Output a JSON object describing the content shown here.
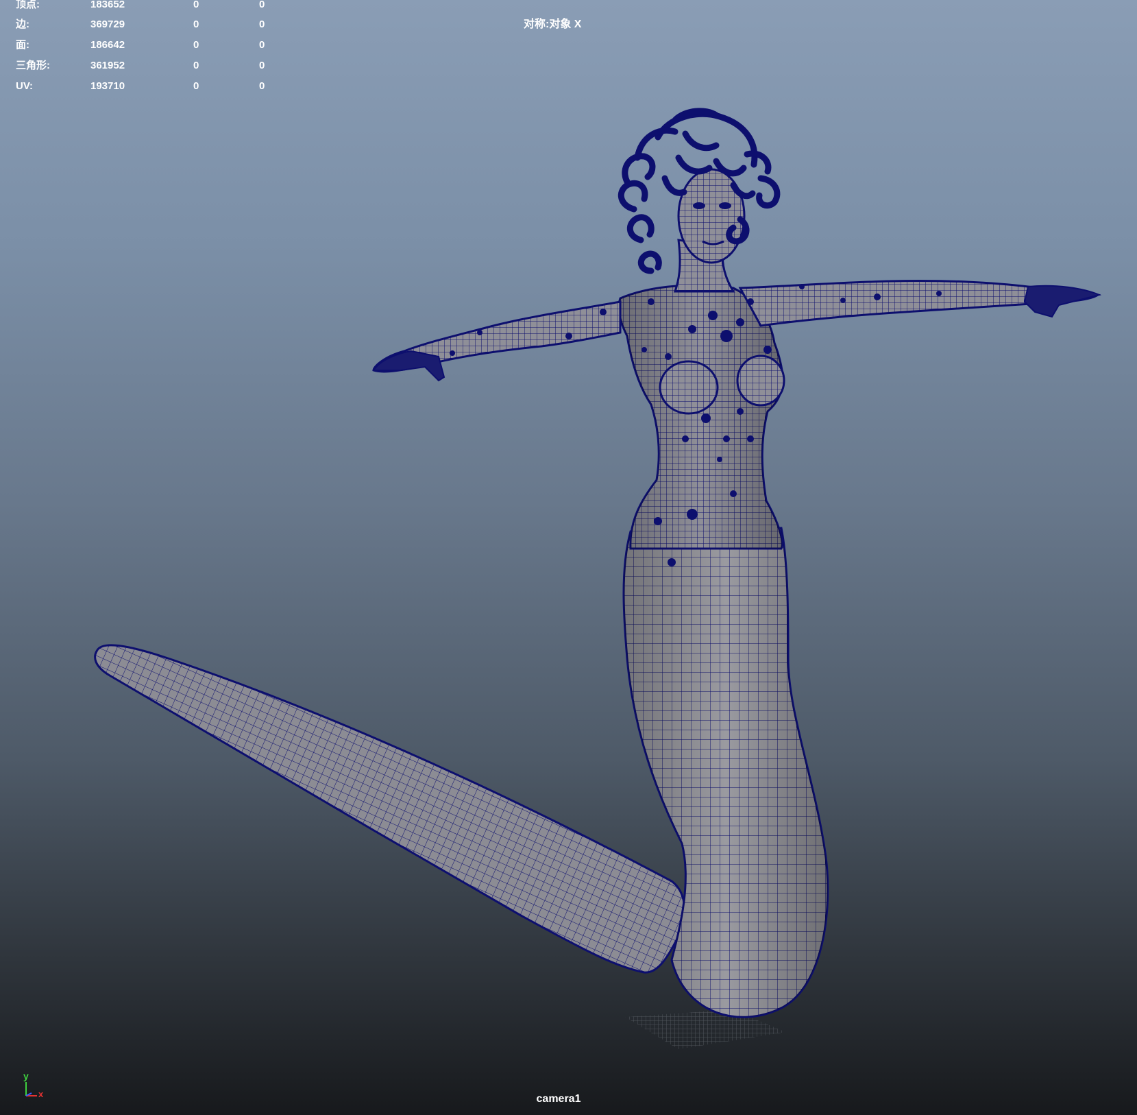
{
  "stats": [
    {
      "label": "顶点:",
      "count": "183652",
      "selected": "0",
      "highlighted": "0"
    },
    {
      "label": "边:",
      "count": "369729",
      "selected": "0",
      "highlighted": "0"
    },
    {
      "label": "面:",
      "count": "186642",
      "selected": "0",
      "highlighted": "0"
    },
    {
      "label": "三角形:",
      "count": "361952",
      "selected": "0",
      "highlighted": "0"
    },
    {
      "label": "UV:",
      "count": "193710",
      "selected": "0",
      "highlighted": "0"
    }
  ],
  "symmetry": "对称:对象 X",
  "camera": "camera1",
  "axis": {
    "y": "y",
    "x": "x"
  },
  "colors": {
    "wireframe": "#0d0f6e",
    "mesh_fill": "#9a9aa0",
    "axis_y": "#3fd23f",
    "axis_x": "#e23232",
    "axis_z": "#3a5cff"
  }
}
